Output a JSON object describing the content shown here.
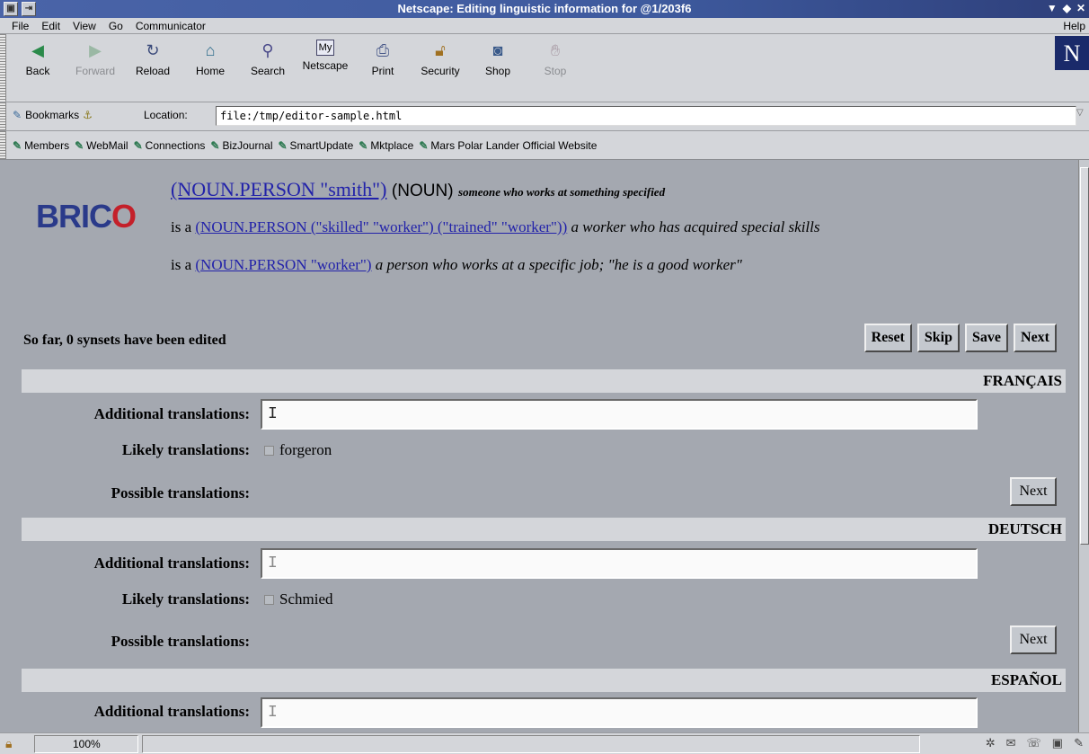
{
  "window": {
    "title": "Netscape: Editing linguistic information for @1/203f6"
  },
  "menu": {
    "items": [
      "File",
      "Edit",
      "View",
      "Go",
      "Communicator"
    ],
    "help": "Help"
  },
  "toolbar": {
    "buttons": [
      {
        "label": "Back",
        "icon": "back-arrow-icon",
        "enabled": true
      },
      {
        "label": "Forward",
        "icon": "forward-arrow-icon",
        "enabled": false
      },
      {
        "label": "Reload",
        "icon": "reload-icon",
        "enabled": true
      },
      {
        "label": "Home",
        "icon": "home-icon",
        "enabled": true
      },
      {
        "label": "Search",
        "icon": "search-icon",
        "enabled": true
      },
      {
        "label": "Netscape",
        "icon": "netscape-icon",
        "enabled": true
      },
      {
        "label": "Print",
        "icon": "print-icon",
        "enabled": true
      },
      {
        "label": "Security",
        "icon": "security-lock-icon",
        "enabled": true
      },
      {
        "label": "Shop",
        "icon": "shop-icon",
        "enabled": true
      },
      {
        "label": "Stop",
        "icon": "stop-icon",
        "enabled": false
      }
    ],
    "logo": "N"
  },
  "location": {
    "bookmarks_label": "Bookmarks",
    "location_label": "Location:",
    "url": "file:/tmp/editor-sample.html"
  },
  "personal_toolbar": {
    "items": [
      "Members",
      "WebMail",
      "Connections",
      "BizJournal",
      "SmartUpdate",
      "Mktplace",
      "Mars Polar Lander Official Website"
    ]
  },
  "page": {
    "logo_text": "BRICO",
    "synset": {
      "head": "(NOUN.PERSON \"smith\")",
      "pos": "(NOUN)",
      "gloss": "someone who works at something specified"
    },
    "hypernyms": [
      {
        "prefix": "is a",
        "link": "(NOUN.PERSON (\"skilled\" \"worker\") (\"trained\" \"worker\"))",
        "gloss": "a worker who has acquired special skills"
      },
      {
        "prefix": "is a",
        "link": "(NOUN.PERSON \"worker\")",
        "gloss": "a person who works at a specific job; \"he is a good worker\""
      }
    ],
    "status_text": "So far, 0 synsets have been edited",
    "actions": {
      "reset": "Reset",
      "skip": "Skip",
      "save": "Save",
      "next": "Next"
    },
    "labels": {
      "additional": "Additional translations:",
      "likely": "Likely translations:",
      "possible": "Possible translations:",
      "next": "Next"
    },
    "languages": [
      {
        "name": "FRANÇAIS",
        "additional_value": "",
        "likely": "forgeron",
        "likely_checked": false
      },
      {
        "name": "DEUTSCH",
        "additional_value": "",
        "likely": "Schmied",
        "likely_checked": false
      },
      {
        "name": "ESPAÑOL",
        "additional_value": ""
      }
    ]
  },
  "statusbar": {
    "zoom": "100%"
  },
  "colors": {
    "page_bg": "#a4a8b0",
    "link": "#2222aa",
    "titlebar": "#3e5a9e",
    "header_band": "#d4d6da"
  }
}
